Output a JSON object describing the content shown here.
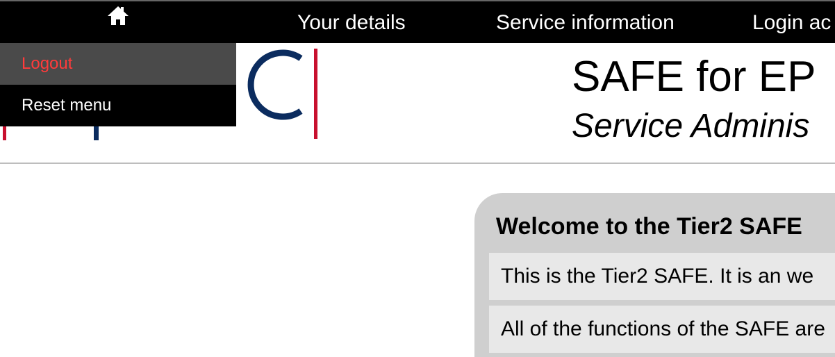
{
  "nav": {
    "home_icon": "home-icon",
    "items": [
      {
        "label": "Your details"
      },
      {
        "label": "Service information"
      },
      {
        "label": "Login ac"
      }
    ]
  },
  "dropdown": {
    "items": [
      {
        "label": "Logout",
        "color": "#ff3b3b"
      },
      {
        "label": "Reset menu",
        "color": "#ffffff"
      }
    ]
  },
  "header": {
    "logo_icon": "epcc-logo",
    "title": "SAFE for EP",
    "subtitle": "Service Adminis"
  },
  "welcome": {
    "heading": "Welcome to the Tier2 SAFE",
    "paragraphs": [
      "This is the Tier2 SAFE. It is an we",
      "All of the functions of the SAFE are"
    ]
  },
  "colors": {
    "nav_background": "#000000",
    "logo_red": "#c8102e",
    "logo_blue": "#0b2c5f",
    "panel_gray": "#cfcfcf"
  }
}
